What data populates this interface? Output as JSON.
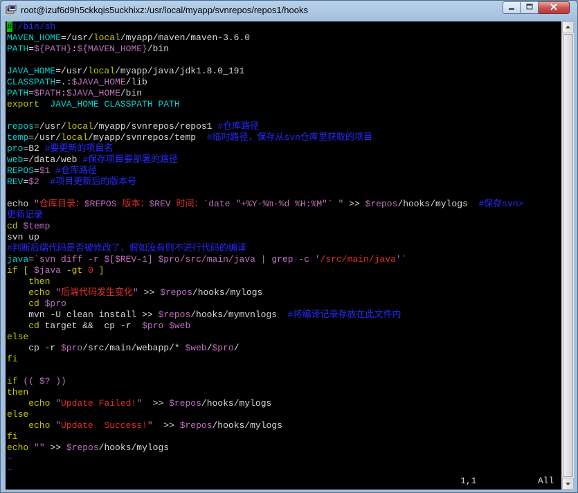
{
  "window": {
    "title": "root@izuf6d9h5ckkqis5uckhixz:/usr/local/myapp/svnrepos/repos1/hooks"
  },
  "colors": {
    "terminal_bg": "#000000",
    "default_text": "#d8d8d8",
    "variable": "#00d4d4",
    "expansion": "#c070c0",
    "keyword": "#c8c800",
    "string": "#e03030",
    "comment": "#2828ff",
    "tilde": "#3050ff",
    "cursor": "#00c000"
  },
  "icons": {
    "app": "putty-terminal-icon",
    "minimize": "minimize-icon",
    "maximize": "maximize-icon",
    "close": "close-icon",
    "scroll_up": "arrow-up-icon",
    "scroll_down": "arrow-down-icon"
  },
  "editor": {
    "lines": [
      [
        {
          "t": "#",
          "c": "cursor"
        },
        {
          "t": "!/bin/sh",
          "c": "b"
        }
      ],
      [
        {
          "t": "MAVEN_HOME",
          "c": "g"
        },
        {
          "t": "=/usr/",
          "c": "d"
        },
        {
          "t": "local",
          "c": "y"
        },
        {
          "t": "/myapp/maven/maven-3.6.0",
          "c": "d"
        }
      ],
      [
        {
          "t": "PATH",
          "c": "g"
        },
        {
          "t": "=",
          "c": "d"
        },
        {
          "t": "${PATH}",
          "c": "p"
        },
        {
          "t": ":",
          "c": "d"
        },
        {
          "t": "${MAVEN_HOME}",
          "c": "p"
        },
        {
          "t": "/bin",
          "c": "d"
        }
      ],
      [],
      [
        {
          "t": "JAVA_HOME",
          "c": "g"
        },
        {
          "t": "=/usr/",
          "c": "d"
        },
        {
          "t": "local",
          "c": "y"
        },
        {
          "t": "/myapp/java/jdk1.8.0_191",
          "c": "d"
        }
      ],
      [
        {
          "t": "CLASSPATH",
          "c": "g"
        },
        {
          "t": "=.:",
          "c": "d"
        },
        {
          "t": "$JAVA_HOME",
          "c": "p"
        },
        {
          "t": "/lib",
          "c": "d"
        }
      ],
      [
        {
          "t": "PATH",
          "c": "g"
        },
        {
          "t": "=",
          "c": "d"
        },
        {
          "t": "$PATH",
          "c": "p"
        },
        {
          "t": ":",
          "c": "d"
        },
        {
          "t": "$JAVA_HOME",
          "c": "p"
        },
        {
          "t": "/bin",
          "c": "d"
        }
      ],
      [
        {
          "t": "export",
          "c": "y"
        },
        {
          "t": "  JAVA_HOME CLASSPATH PATH",
          "c": "g"
        }
      ],
      [],
      [
        {
          "t": "repos",
          "c": "g"
        },
        {
          "t": "=/usr/",
          "c": "d"
        },
        {
          "t": "local",
          "c": "y"
        },
        {
          "t": "/myapp/svnrepos/repos1 ",
          "c": "d"
        },
        {
          "t": "#仓库路径",
          "c": "b"
        }
      ],
      [
        {
          "t": "temp",
          "c": "g"
        },
        {
          "t": "=/usr/",
          "c": "d"
        },
        {
          "t": "local",
          "c": "y"
        },
        {
          "t": "/myapp/svnrepos/temp  ",
          "c": "d"
        },
        {
          "t": "#临时路径，保存从svn仓库里获取的项目",
          "c": "b"
        }
      ],
      [
        {
          "t": "pro",
          "c": "g"
        },
        {
          "t": "=B2 ",
          "c": "d"
        },
        {
          "t": "#要更新的项目名",
          "c": "b"
        }
      ],
      [
        {
          "t": "web",
          "c": "g"
        },
        {
          "t": "=/data/web ",
          "c": "d"
        },
        {
          "t": "#保存项目要部署的路径",
          "c": "b"
        }
      ],
      [
        {
          "t": "REPOS",
          "c": "g"
        },
        {
          "t": "=",
          "c": "d"
        },
        {
          "t": "$1",
          "c": "p"
        },
        {
          "t": " #仓库路径",
          "c": "b"
        }
      ],
      [
        {
          "t": "REV",
          "c": "g"
        },
        {
          "t": "=",
          "c": "d"
        },
        {
          "t": "$2",
          "c": "p"
        },
        {
          "t": "  #项目更新后的版本号",
          "c": "b"
        }
      ],
      [],
      [
        {
          "t": "echo ",
          "c": "d"
        },
        {
          "t": "\"",
          "c": "p"
        },
        {
          "t": "仓库目录：",
          "c": "r"
        },
        {
          "t": "$REPOS",
          "c": "p"
        },
        {
          "t": " 版本：",
          "c": "r"
        },
        {
          "t": "$REV",
          "c": "p"
        },
        {
          "t": " 时间：",
          "c": "r"
        },
        {
          "t": "`date \"+%Y-%m-%d %H:%M\"`",
          "c": "p"
        },
        {
          "t": " ",
          "c": "r"
        },
        {
          "t": "\"",
          "c": "p"
        },
        {
          "t": " >> ",
          "c": "d"
        },
        {
          "t": "$repos",
          "c": "p"
        },
        {
          "t": "/hooks/mylogs  ",
          "c": "d"
        },
        {
          "t": "#保存svn>",
          "c": "b"
        }
      ],
      [
        {
          "t": "更新记录",
          "c": "b"
        }
      ],
      [
        {
          "t": "cd ",
          "c": "y"
        },
        {
          "t": "$temp",
          "c": "p"
        }
      ],
      [
        {
          "t": "svn up",
          "c": "d"
        }
      ],
      [
        {
          "t": "#判断后端代码是否被修改了，假如没有则不进行代码的编译",
          "c": "b"
        }
      ],
      [
        {
          "t": "java",
          "c": "g"
        },
        {
          "t": "=",
          "c": "d"
        },
        {
          "t": "`svn diff -r ",
          "c": "p"
        },
        {
          "t": "$[",
          "c": "p"
        },
        {
          "t": "$REV",
          "c": "p"
        },
        {
          "t": "-1]",
          "c": "p"
        },
        {
          "t": " ",
          "c": "p"
        },
        {
          "t": "$pro",
          "c": "p"
        },
        {
          "t": "/src/main/java | grep -c ",
          "c": "p"
        },
        {
          "t": "'",
          "c": "p"
        },
        {
          "t": "/src/main/java",
          "c": "r"
        },
        {
          "t": "'`",
          "c": "p"
        }
      ],
      [
        {
          "t": "if",
          "c": "y"
        },
        {
          "t": " [ ",
          "c": "y"
        },
        {
          "t": "$java",
          "c": "p"
        },
        {
          "t": " -gt ",
          "c": "y"
        },
        {
          "t": "0",
          "c": "r"
        },
        {
          "t": " ]",
          "c": "y"
        }
      ],
      [
        {
          "t": "    then",
          "c": "y"
        }
      ],
      [
        {
          "t": "    echo ",
          "c": "y"
        },
        {
          "t": "\"",
          "c": "p"
        },
        {
          "t": "后端代码发生变化",
          "c": "r"
        },
        {
          "t": "\"",
          "c": "p"
        },
        {
          "t": " >> ",
          "c": "d"
        },
        {
          "t": "$repos",
          "c": "p"
        },
        {
          "t": "/hooks/mylogs",
          "c": "d"
        }
      ],
      [
        {
          "t": "    cd ",
          "c": "y"
        },
        {
          "t": "$pro",
          "c": "p"
        }
      ],
      [
        {
          "t": "    mvn -U clean install >> ",
          "c": "d"
        },
        {
          "t": "$repos",
          "c": "p"
        },
        {
          "t": "/hooks/mymvnlogs  ",
          "c": "d"
        },
        {
          "t": "#将编译记录存放在此文件内",
          "c": "b"
        }
      ],
      [
        {
          "t": "    cd ",
          "c": "y"
        },
        {
          "t": "target && ",
          "c": "d"
        },
        {
          "t": " cp -r  ",
          "c": "d"
        },
        {
          "t": "$pro",
          "c": "p"
        },
        {
          "t": " ",
          "c": "d"
        },
        {
          "t": "$web",
          "c": "p"
        }
      ],
      [
        {
          "t": "else",
          "c": "y"
        }
      ],
      [
        {
          "t": "    cp -r ",
          "c": "d"
        },
        {
          "t": "$pro",
          "c": "p"
        },
        {
          "t": "/src/main/webapp/* ",
          "c": "d"
        },
        {
          "t": "$web",
          "c": "p"
        },
        {
          "t": "/",
          "c": "d"
        },
        {
          "t": "$pro",
          "c": "p"
        },
        {
          "t": "/",
          "c": "d"
        }
      ],
      [
        {
          "t": "fi",
          "c": "y"
        }
      ],
      [],
      [
        {
          "t": "if",
          "c": "y"
        },
        {
          "t": " (( ",
          "c": "p"
        },
        {
          "t": "$?",
          "c": "p"
        },
        {
          "t": " ))",
          "c": "p"
        }
      ],
      [
        {
          "t": "then",
          "c": "y"
        }
      ],
      [
        {
          "t": "    echo ",
          "c": "y"
        },
        {
          "t": "\"",
          "c": "p"
        },
        {
          "t": "Update Failed!",
          "c": "r"
        },
        {
          "t": "\"",
          "c": "p"
        },
        {
          "t": "  >> ",
          "c": "d"
        },
        {
          "t": "$repos",
          "c": "p"
        },
        {
          "t": "/hooks/mylogs",
          "c": "d"
        }
      ],
      [
        {
          "t": "else",
          "c": "y"
        }
      ],
      [
        {
          "t": "    echo ",
          "c": "y"
        },
        {
          "t": "\"",
          "c": "p"
        },
        {
          "t": "Update  Success!",
          "c": "r"
        },
        {
          "t": "\"",
          "c": "p"
        },
        {
          "t": "  >> ",
          "c": "d"
        },
        {
          "t": "$repos",
          "c": "p"
        },
        {
          "t": "/hooks/mylogs",
          "c": "d"
        }
      ],
      [
        {
          "t": "fi",
          "c": "y"
        }
      ],
      [
        {
          "t": "echo ",
          "c": "y"
        },
        {
          "t": "\"\"",
          "c": "p"
        },
        {
          "t": " >> ",
          "c": "d"
        },
        {
          "t": "$repos",
          "c": "p"
        },
        {
          "t": "/hooks/mylogs",
          "c": "d"
        }
      ],
      [
        {
          "t": "~",
          "c": "t"
        }
      ],
      [
        {
          "t": "~",
          "c": "t"
        }
      ]
    ],
    "cursor_position": "1,1",
    "scroll_position": "All"
  }
}
